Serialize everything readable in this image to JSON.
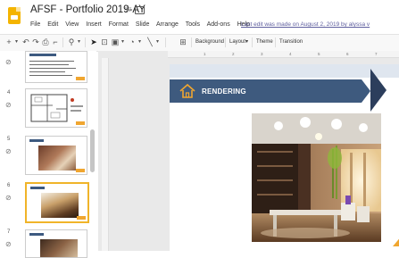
{
  "app": {
    "doc_title": "AFSF - Portfolio 2019-AY",
    "last_edit": "Last edit was made on August 2, 2019 by alyssa v",
    "menus": [
      "File",
      "Edit",
      "View",
      "Insert",
      "Format",
      "Slide",
      "Arrange",
      "Tools",
      "Add-ons",
      "Help"
    ]
  },
  "toolbar": {
    "background_label": "Background",
    "layout_label": "Layout▾",
    "theme_label": "Theme",
    "transition_label": "Transition"
  },
  "filmstrip": {
    "slides": [
      {
        "number": "",
        "selected": false
      },
      {
        "number": "4",
        "selected": false
      },
      {
        "number": "5",
        "selected": false
      },
      {
        "number": "6",
        "selected": true
      },
      {
        "number": "7",
        "selected": false
      }
    ]
  },
  "ruler": {
    "marks": [
      "1",
      "2",
      "3",
      "4",
      "5",
      "6",
      "7"
    ]
  },
  "slide": {
    "title": "RENDERING"
  },
  "colors": {
    "banner": "#3e5a7e",
    "accent": "#f0a630",
    "selection": "#f0b429",
    "docs_yellow": "#f4b400"
  },
  "icons": [
    "slides-logo-icon",
    "star-icon",
    "folder-icon",
    "house-icon",
    "link-icon"
  ]
}
